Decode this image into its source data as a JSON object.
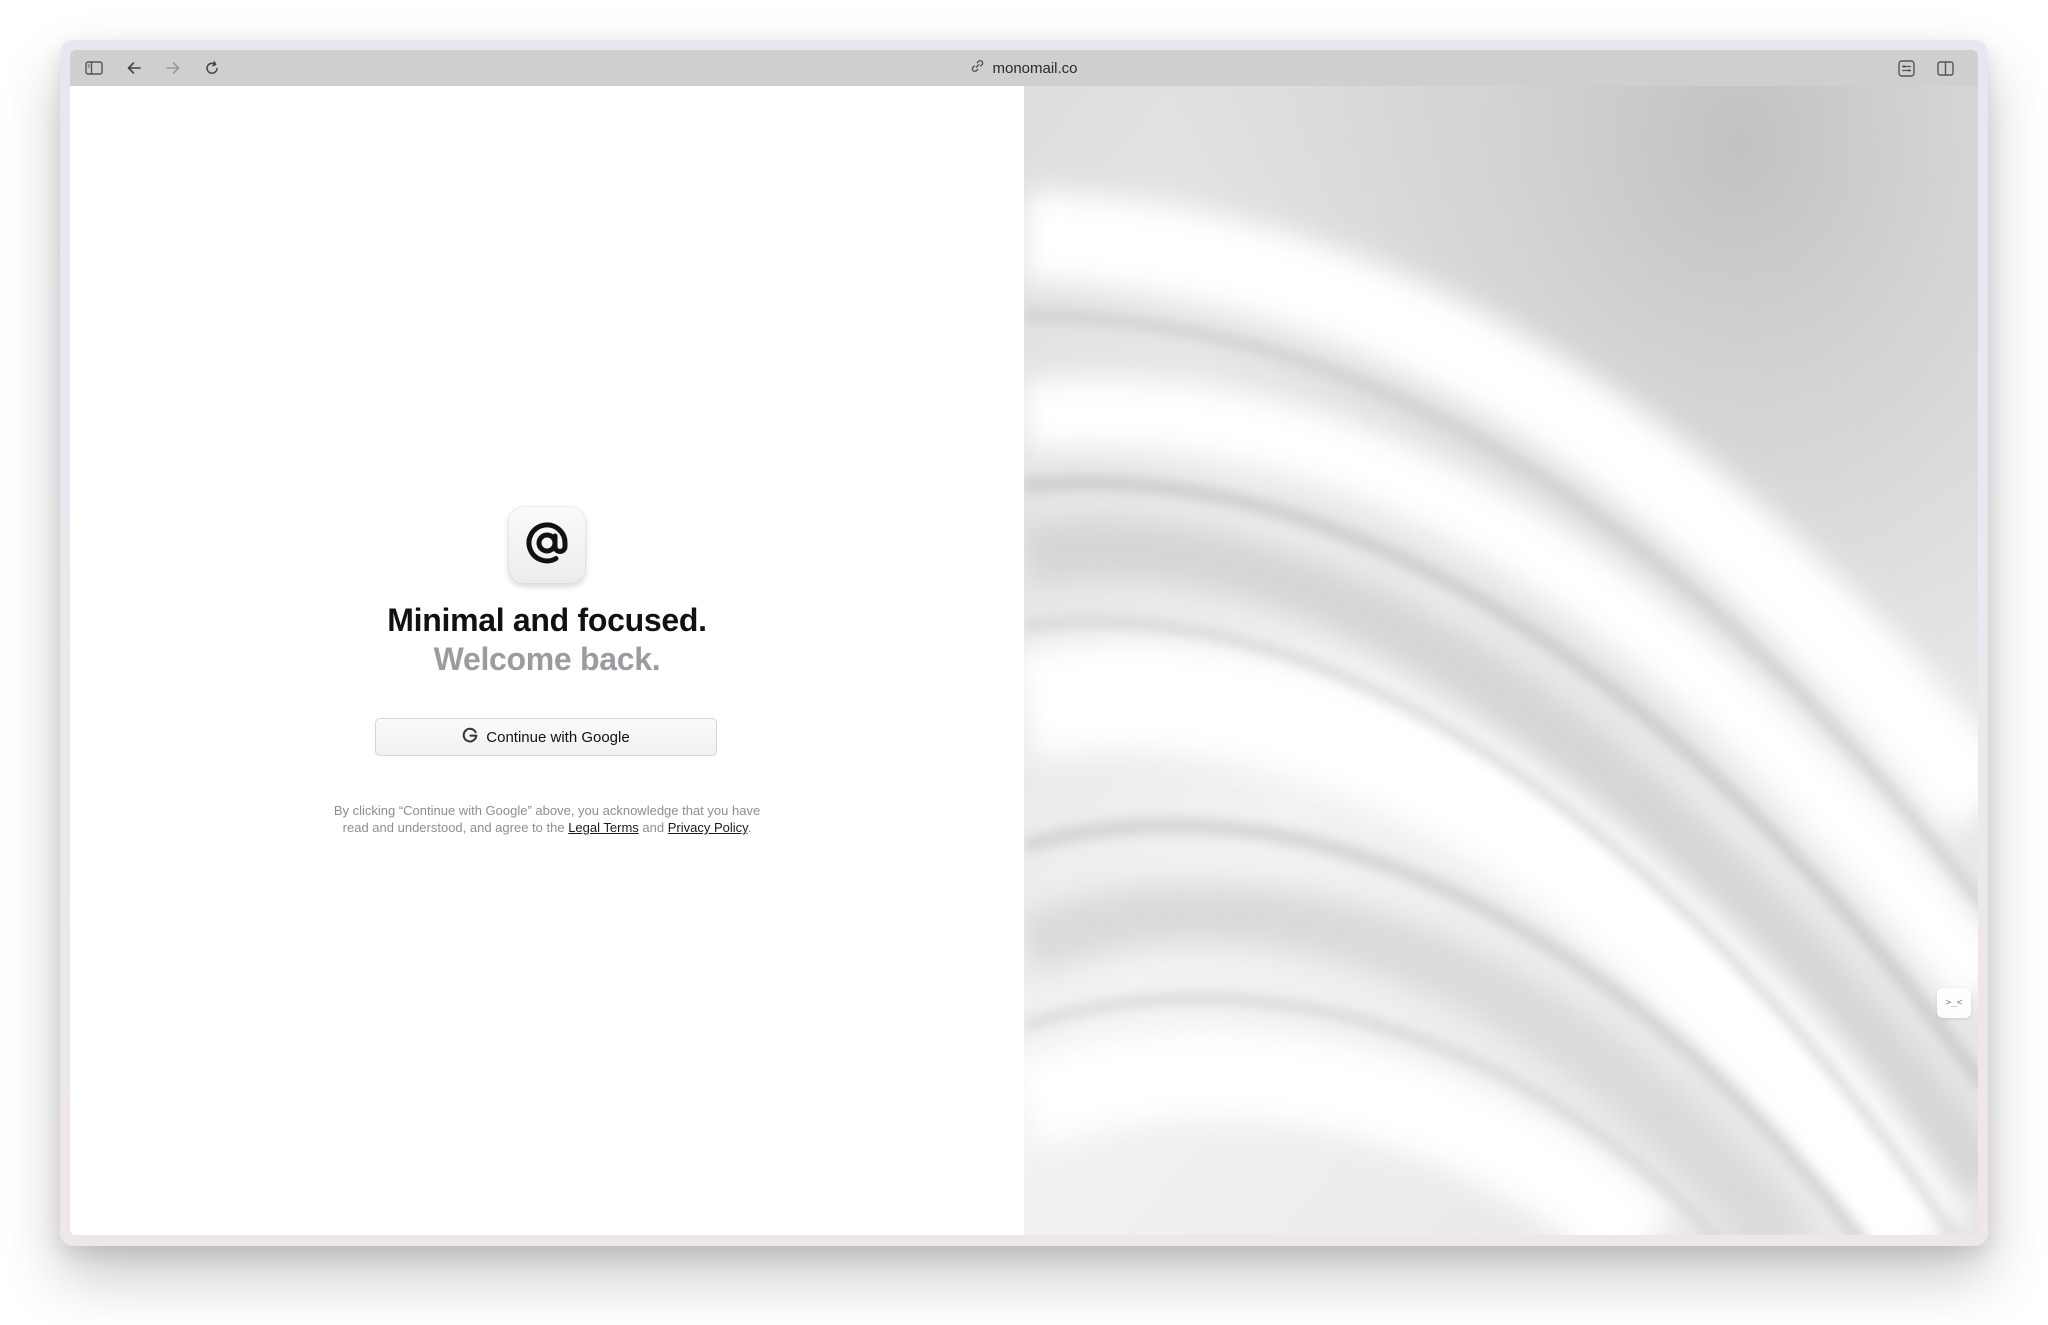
{
  "browser": {
    "url": "monomail.co",
    "icons": {
      "sidebar": "sidebar-icon",
      "back": "arrow-left-icon",
      "forward": "arrow-right-icon",
      "reload": "reload-icon",
      "link": "link-icon",
      "reader": "reader-icon",
      "split": "split-view-icon"
    }
  },
  "login": {
    "logo_icon": "at-sign-icon",
    "headline": "Minimal and focused.",
    "subhead": "Welcome back.",
    "google_button_label": "Continue with Google",
    "legal_line1": "By clicking “Continue with Google” above, you acknowledge that you have",
    "legal_line2_prefix": "read and understood, and agree to the",
    "legal_terms_link": "Legal Terms",
    "legal_and": "and",
    "privacy_link": "Privacy Policy",
    "legal_end": "."
  },
  "side_widget": {
    "label": ">_<"
  },
  "colors": {
    "toolbar": "#cfcfcf",
    "headline": "#111111",
    "subhead": "#9b9ba0",
    "legal_text": "#8e8e8e"
  }
}
